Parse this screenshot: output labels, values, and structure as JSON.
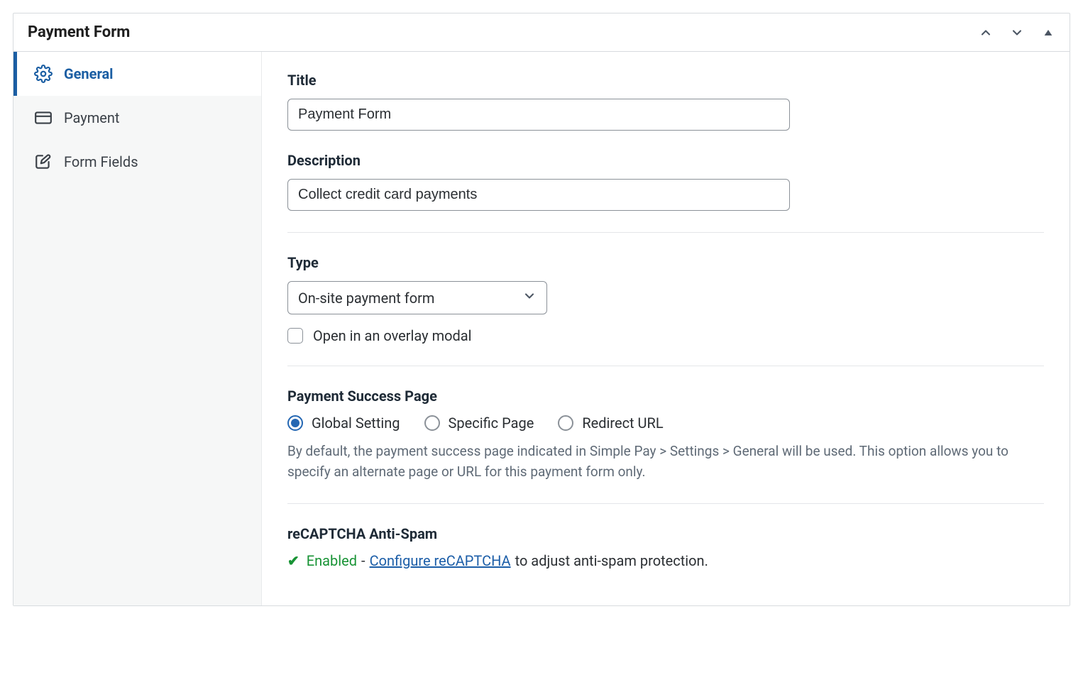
{
  "panel": {
    "title": "Payment Form"
  },
  "sidebar": {
    "items": [
      {
        "label": "General"
      },
      {
        "label": "Payment"
      },
      {
        "label": "Form Fields"
      }
    ]
  },
  "content": {
    "title": {
      "label": "Title",
      "value": "Payment Form"
    },
    "description": {
      "label": "Description",
      "value": "Collect credit card payments"
    },
    "type": {
      "label": "Type",
      "selected": "On-site payment form",
      "overlay_label": "Open in an overlay modal"
    },
    "success_page": {
      "label": "Payment Success Page",
      "options": [
        {
          "label": "Global Setting",
          "checked": true
        },
        {
          "label": "Specific Page",
          "checked": false
        },
        {
          "label": "Redirect URL",
          "checked": false
        }
      ],
      "help": "By default, the payment success page indicated in Simple Pay > Settings > General will be used. This option allows you to specify an alternate page or URL for this payment form only."
    },
    "recaptcha": {
      "label": "reCAPTCHA Anti-Spam",
      "status": "Enabled",
      "separator": " - ",
      "link_text": "Configure reCAPTCHA",
      "trail": " to adjust anti-spam protection."
    }
  }
}
